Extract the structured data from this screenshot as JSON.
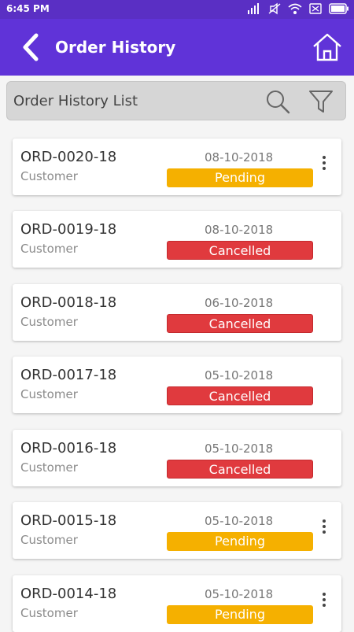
{
  "status_bar": {
    "time": "6:45 PM",
    "icons": [
      "sim-signal-icon",
      "mute-icon",
      "wifi-icon",
      "sim-x-icon",
      "battery-icon"
    ]
  },
  "app_bar": {
    "title": "Order History",
    "back_icon": "chevron-left-icon",
    "home_icon": "home-icon",
    "background": "#6033d8"
  },
  "search": {
    "label": "Order History List",
    "search_icon": "search-icon",
    "filter_icon": "filter-icon"
  },
  "orders": [
    {
      "id": "ORD-0020-18",
      "customer": "Customer",
      "date": "08-10-2018",
      "status": "Pending",
      "menu": true
    },
    {
      "id": "ORD-0019-18",
      "customer": "Customer",
      "date": "08-10-2018",
      "status": "Cancelled",
      "menu": false
    },
    {
      "id": "ORD-0018-18",
      "customer": "Customer",
      "date": "06-10-2018",
      "status": "Cancelled",
      "menu": false
    },
    {
      "id": "ORD-0017-18",
      "customer": "Customer",
      "date": "05-10-2018",
      "status": "Cancelled",
      "menu": false
    },
    {
      "id": "ORD-0016-18",
      "customer": "Customer",
      "date": "05-10-2018",
      "status": "Cancelled",
      "menu": false
    },
    {
      "id": "ORD-0015-18",
      "customer": "Customer",
      "date": "05-10-2018",
      "status": "Pending",
      "menu": true
    },
    {
      "id": "ORD-0014-18",
      "customer": "Customer",
      "date": "05-10-2018",
      "status": "Pending",
      "menu": true
    }
  ],
  "colors": {
    "pending": "#f5b000",
    "cancelled": "#e03a3e"
  }
}
